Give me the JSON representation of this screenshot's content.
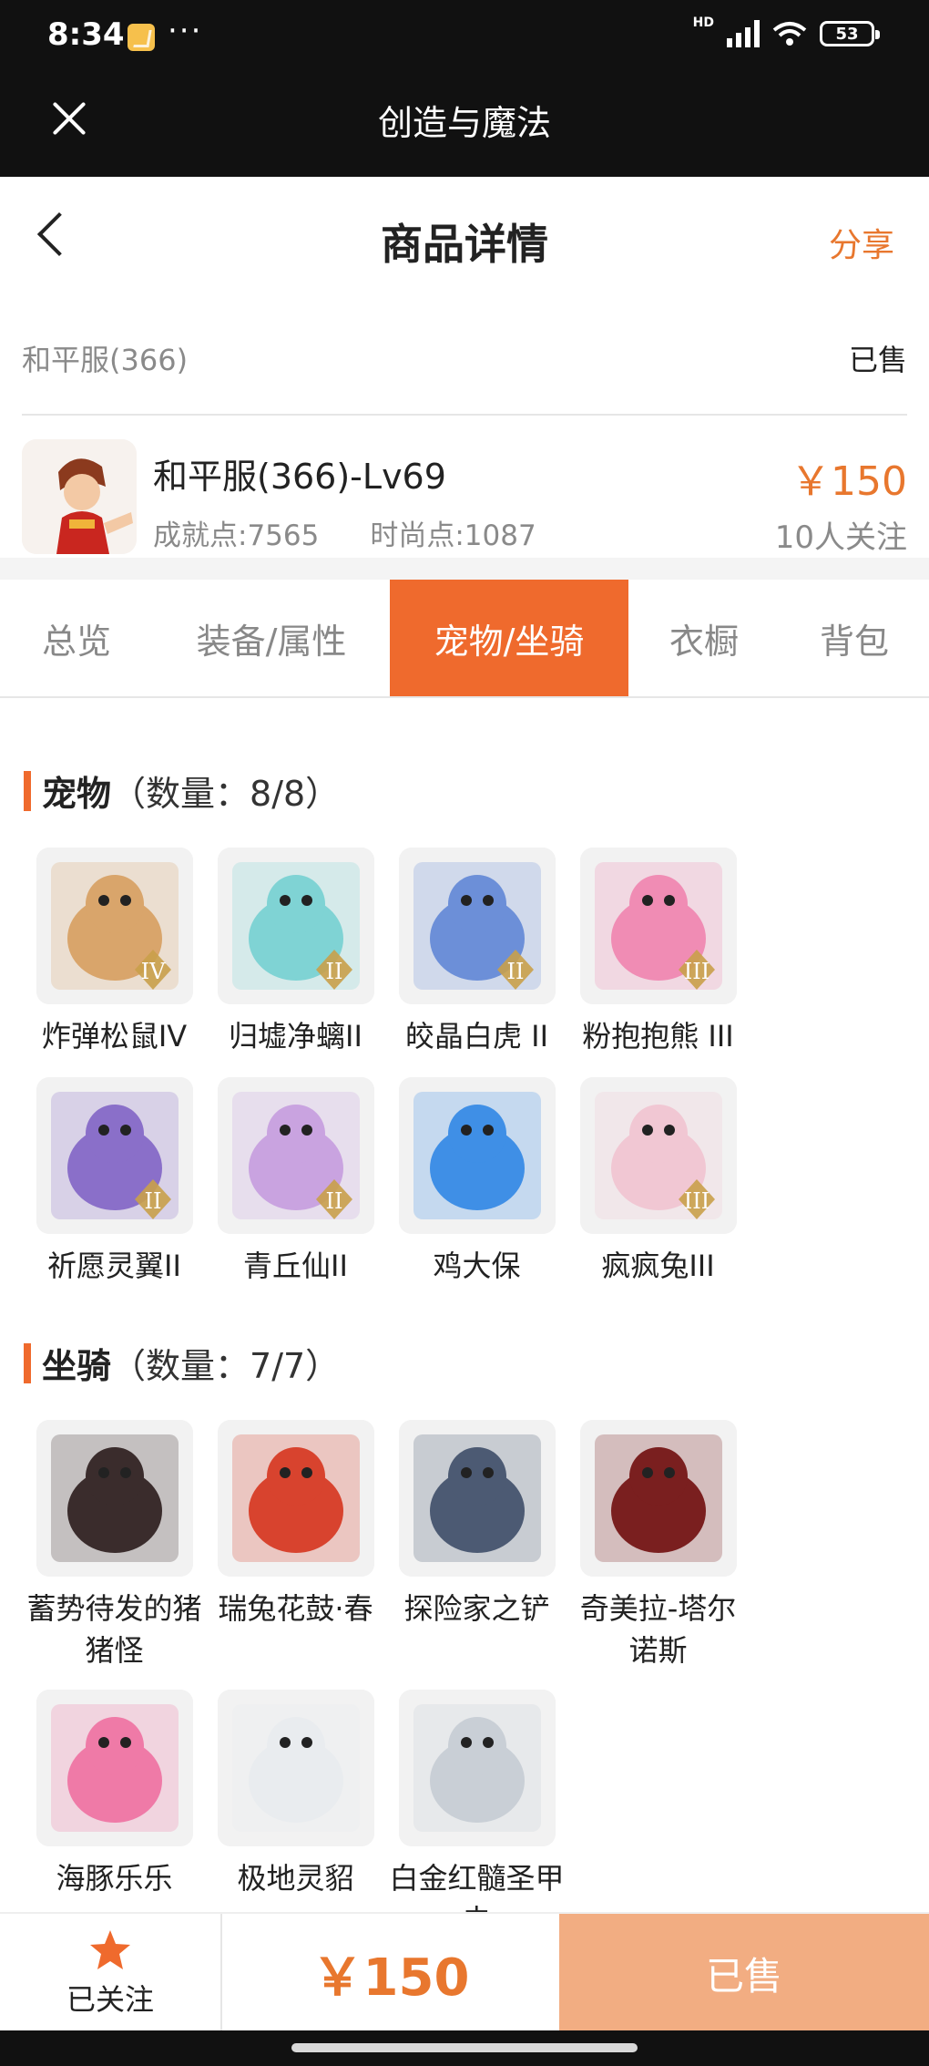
{
  "status_bar": {
    "time": "8:34",
    "dots": "···",
    "network": "HD",
    "battery": "53"
  },
  "webview": {
    "title": "创造与魔法"
  },
  "nav": {
    "title": "商品详情",
    "share": "分享"
  },
  "server": {
    "name": "和平服(366)",
    "status": "已售"
  },
  "product": {
    "name": "和平服(366)-Lv69",
    "achievement": "成就点:7565",
    "fashion": "时尚点:1087",
    "price": "￥150",
    "followers": "10人关注"
  },
  "tabs": [
    {
      "label": "总览",
      "active": false
    },
    {
      "label": "装备/属性",
      "active": false
    },
    {
      "label": "宠物/坐骑",
      "active": true
    },
    {
      "label": "衣橱",
      "active": false
    },
    {
      "label": "背包",
      "active": false
    }
  ],
  "pets": {
    "title": "宠物",
    "count": "（数量：8/8）",
    "items": [
      {
        "label": "炸弹松鼠IV",
        "icon": "squirrel-pet-icon",
        "tier": "IV",
        "color": "#d9a56b"
      },
      {
        "label": "归墟净螭II",
        "icon": "dragon-pet-icon",
        "tier": "II",
        "color": "#7fd3d4"
      },
      {
        "label": "皎晶白虎 II",
        "icon": "tiger-pet-icon",
        "tier": "II",
        "color": "#6c8fd8"
      },
      {
        "label": "粉抱抱熊 III",
        "icon": "pink-bear-pet-icon",
        "tier": "III",
        "color": "#f08cb4"
      },
      {
        "label": "祈愿灵翼II",
        "icon": "griffin-pet-icon",
        "tier": "II",
        "color": "#8a6fc9"
      },
      {
        "label": "青丘仙II",
        "icon": "fox-fairy-pet-icon",
        "tier": "II",
        "color": "#c9a3e0"
      },
      {
        "label": "鸡大保",
        "icon": "blue-chick-pet-icon",
        "tier": "",
        "color": "#3f8fe6"
      },
      {
        "label": "疯疯兔III",
        "icon": "rabbit-pet-icon",
        "tier": "III",
        "color": "#f1c7d3"
      }
    ]
  },
  "mounts": {
    "title": "坐骑",
    "count": "（数量：7/7）",
    "items": [
      {
        "label": "蓄势待发的猪猪怪",
        "icon": "pig-mount-icon",
        "color": "#3a2c2c"
      },
      {
        "label": "瑞兔花鼓·春",
        "icon": "drum-mount-icon",
        "color": "#d8432e"
      },
      {
        "label": "探险家之铲",
        "icon": "shovel-mount-icon",
        "color": "#4c5a73"
      },
      {
        "label": "奇美拉-塔尔诺斯",
        "icon": "chimera-mount-icon",
        "color": "#7a1f1f"
      },
      {
        "label": "海豚乐乐",
        "icon": "dolphin-mount-icon",
        "color": "#ef7aa7"
      },
      {
        "label": "极地灵貂",
        "icon": "marten-mount-icon",
        "color": "#e9ecef"
      },
      {
        "label": "白金红髓圣甲虫",
        "icon": "beetle-mount-icon",
        "color": "#c9cfd6"
      }
    ]
  },
  "bottom": {
    "follow": "已关注",
    "price": "￥150",
    "sold": "已售"
  },
  "colors": {
    "accent": "#ef6a2d",
    "price": "#e8772e",
    "sold_button": "#f2ad82"
  }
}
